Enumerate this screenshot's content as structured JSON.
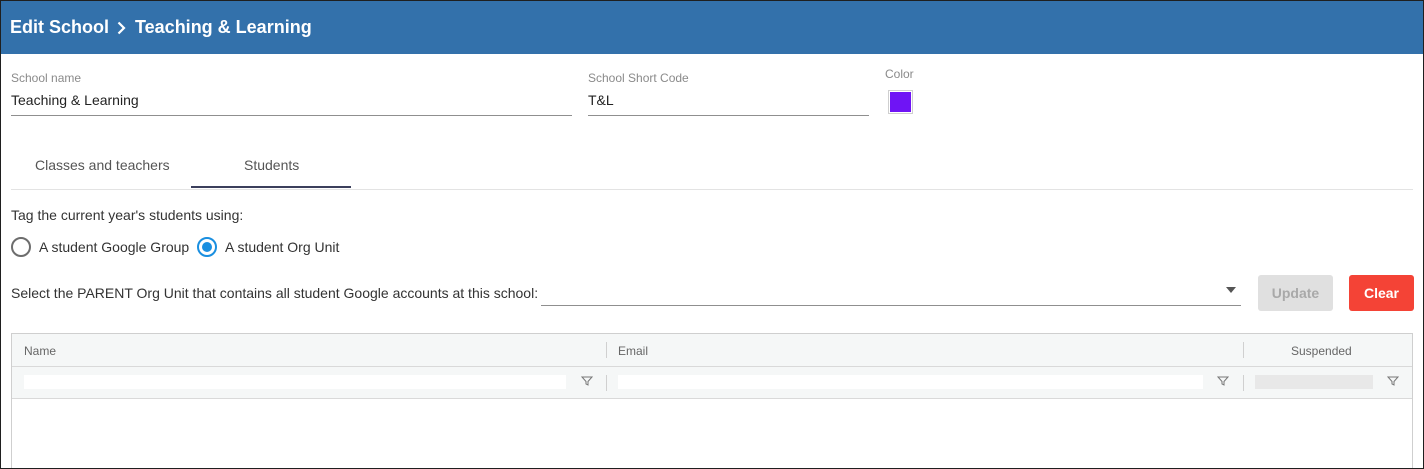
{
  "header": {
    "breadcrumb_parent": "Edit School",
    "breadcrumb_current": "Teaching & Learning",
    "background_color": "#3371ab"
  },
  "form": {
    "school_name": {
      "label": "School name",
      "value": "Teaching & Learning"
    },
    "short_code": {
      "label": "School Short Code",
      "value": "T&L"
    },
    "color": {
      "label": "Color",
      "value": "#6f14f5"
    }
  },
  "tabs": [
    {
      "label": "Classes and teachers",
      "active": false
    },
    {
      "label": "Students",
      "active": true
    }
  ],
  "students": {
    "prompt": "Tag the current year's students using:",
    "options": [
      {
        "label": "A student Google Group",
        "selected": false
      },
      {
        "label": "A student Org Unit",
        "selected": true
      }
    ],
    "org_unit_label": "Select the PARENT Org Unit that contains all student Google accounts at this school:",
    "org_unit_value": "",
    "update_label": "Update",
    "clear_label": "Clear",
    "clear_color": "#f44336",
    "accent_color": "#1a8fe0"
  },
  "grid": {
    "columns": [
      "Name",
      "Email",
      "Suspended"
    ],
    "rows": []
  }
}
